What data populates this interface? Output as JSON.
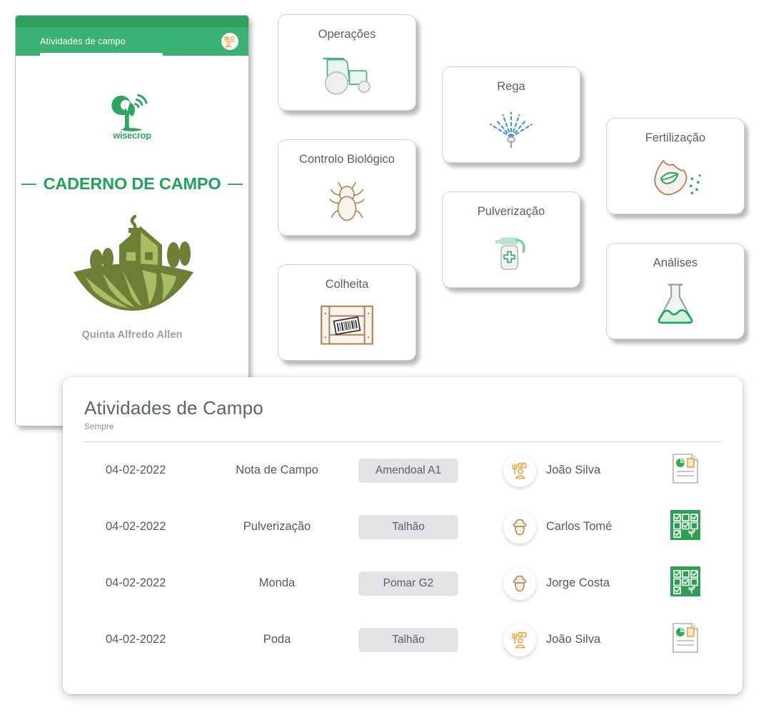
{
  "phone": {
    "header_title": "Atividades de campo",
    "header_avatar_icon": "farmer-avatar-icon",
    "logo_name": "wisecrop",
    "logo_wordmark": "wisecrop",
    "section_title": "CADERNO DE CAMPO",
    "farm_illustration_icon": "farm-house-fields-icon",
    "farm_name": "Quinta Alfredo Allen"
  },
  "cards": [
    {
      "label": "Operações",
      "icon": "tractor-icon"
    },
    {
      "label": "Controlo Biológico",
      "icon": "beetle-icon"
    },
    {
      "label": "Colheita",
      "icon": "harvest-crate-icon"
    },
    {
      "label": "Rega",
      "icon": "sprinkler-icon"
    },
    {
      "label": "Pulverização",
      "icon": "spray-bottle-icon"
    },
    {
      "label": "Fertilização",
      "icon": "fertilizer-bag-icon"
    },
    {
      "label": "Análises",
      "icon": "flask-icon"
    }
  ],
  "activities": {
    "title": "Atividades de Campo",
    "subtitle": "Sempre",
    "rows": [
      {
        "date": "04-02-2022",
        "type": "Nota de Campo",
        "plot": "Amendoal A1",
        "user": "João Silva",
        "avatar_icon": "farmer-tools-avatar-icon",
        "doc_icon": "report-document-icon"
      },
      {
        "date": "04-02-2022",
        "type": "Pulverização",
        "plot": "Talhão",
        "user": "Carlos Tomé",
        "avatar_icon": "farmer-hat-avatar-icon",
        "doc_icon": "spreadsheet-checklist-icon"
      },
      {
        "date": "04-02-2022",
        "type": "Monda",
        "plot": "Pomar G2",
        "user": "Jorge Costa",
        "avatar_icon": "farmer-hat-avatar-icon",
        "doc_icon": "spreadsheet-checklist-icon"
      },
      {
        "date": "04-02-2022",
        "type": "Poda",
        "plot": "Talhão",
        "user": "João Silva",
        "avatar_icon": "farmer-tools-avatar-icon",
        "doc_icon": "report-document-icon"
      }
    ]
  },
  "colors": {
    "brand_green": "#3bb273",
    "brand_green_dark": "#31a05f",
    "title_green": "#22a05c",
    "accent_orange": "#f0a23c",
    "sheet_green": "#37a35f",
    "text_grey": "#55595d",
    "chip_grey": "#e2e3e4"
  }
}
